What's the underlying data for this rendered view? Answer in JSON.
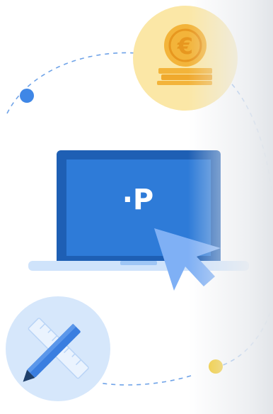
{
  "illustration": {
    "logo_text": "·P",
    "colors": {
      "laptop_frame": "#1e5fb4",
      "laptop_screen": "#2e7bd8",
      "laptop_base": "#cfe3fb",
      "cursor": "#7fb0f5",
      "coin_circle": "#fbe7a6",
      "coin": "#f3b43a",
      "tools_circle": "#d6e7fb",
      "pencil": "#3a7ee0",
      "dash_line": "#6fa3e8",
      "dot_blue": "#3f87e6",
      "dot_yellow": "#f2c619"
    },
    "icons": [
      "euro-coin-icon",
      "laptop-icon",
      "cursor-arrow-icon",
      "ruler-pencil-icon"
    ]
  }
}
